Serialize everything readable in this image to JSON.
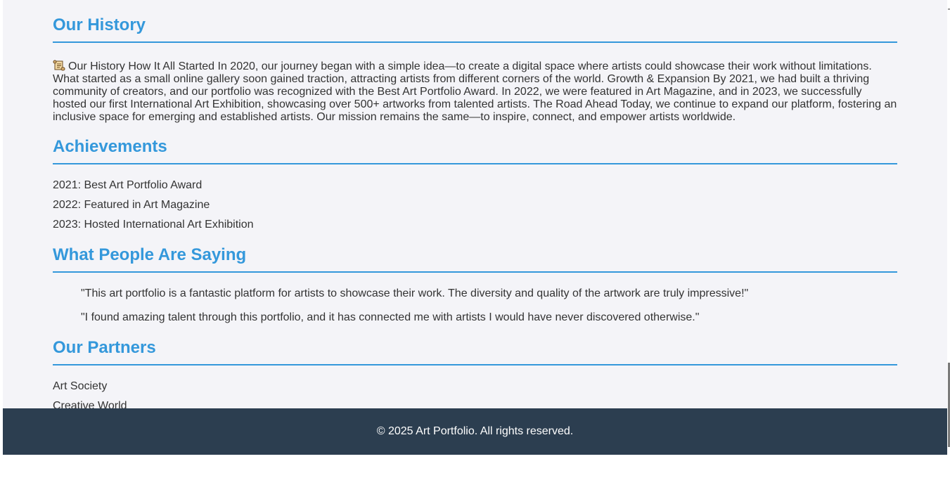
{
  "history": {
    "heading": "Our History",
    "scroll_icon": "scroll-icon",
    "body": "Our History How It All Started In 2020, our journey began with a simple idea—to create a digital space where artists could showcase their work without limitations. What started as a small online gallery soon gained traction, attracting artists from different corners of the world. Growth & Expansion By 2021, we had built a thriving community of creators, and our portfolio was recognized with the Best Art Portfolio Award. In 2022, we were featured in Art Magazine, and in 2023, we successfully hosted our first International Art Exhibition, showcasing over 500+ artworks from talented artists. The Road Ahead Today, we continue to expand our platform, fostering an inclusive space for emerging and established artists. Our mission remains the same—to inspire, connect, and empower artists worldwide."
  },
  "achievements": {
    "heading": "Achievements",
    "items": [
      "2021: Best Art Portfolio Award",
      "2022: Featured in Art Magazine",
      "2023: Hosted International Art Exhibition"
    ]
  },
  "testimonials": {
    "heading": "What People Are Saying",
    "items": [
      "\"This art portfolio is a fantastic platform for artists to showcase their work. The diversity and quality of the artwork are truly impressive!\"",
      "\"I found amazing talent through this portfolio, and it has connected me with artists I would have never discovered otherwise.\""
    ]
  },
  "partners": {
    "heading": "Our Partners",
    "items": [
      "Art Society",
      "Creative World"
    ]
  },
  "footer": {
    "text": "© 2025 Art Portfolio. All rights reserved."
  },
  "colors": {
    "accent": "#3498db",
    "footer_bg": "#2c3e50",
    "page_bg": "#f4f4f8",
    "text": "#333333"
  }
}
